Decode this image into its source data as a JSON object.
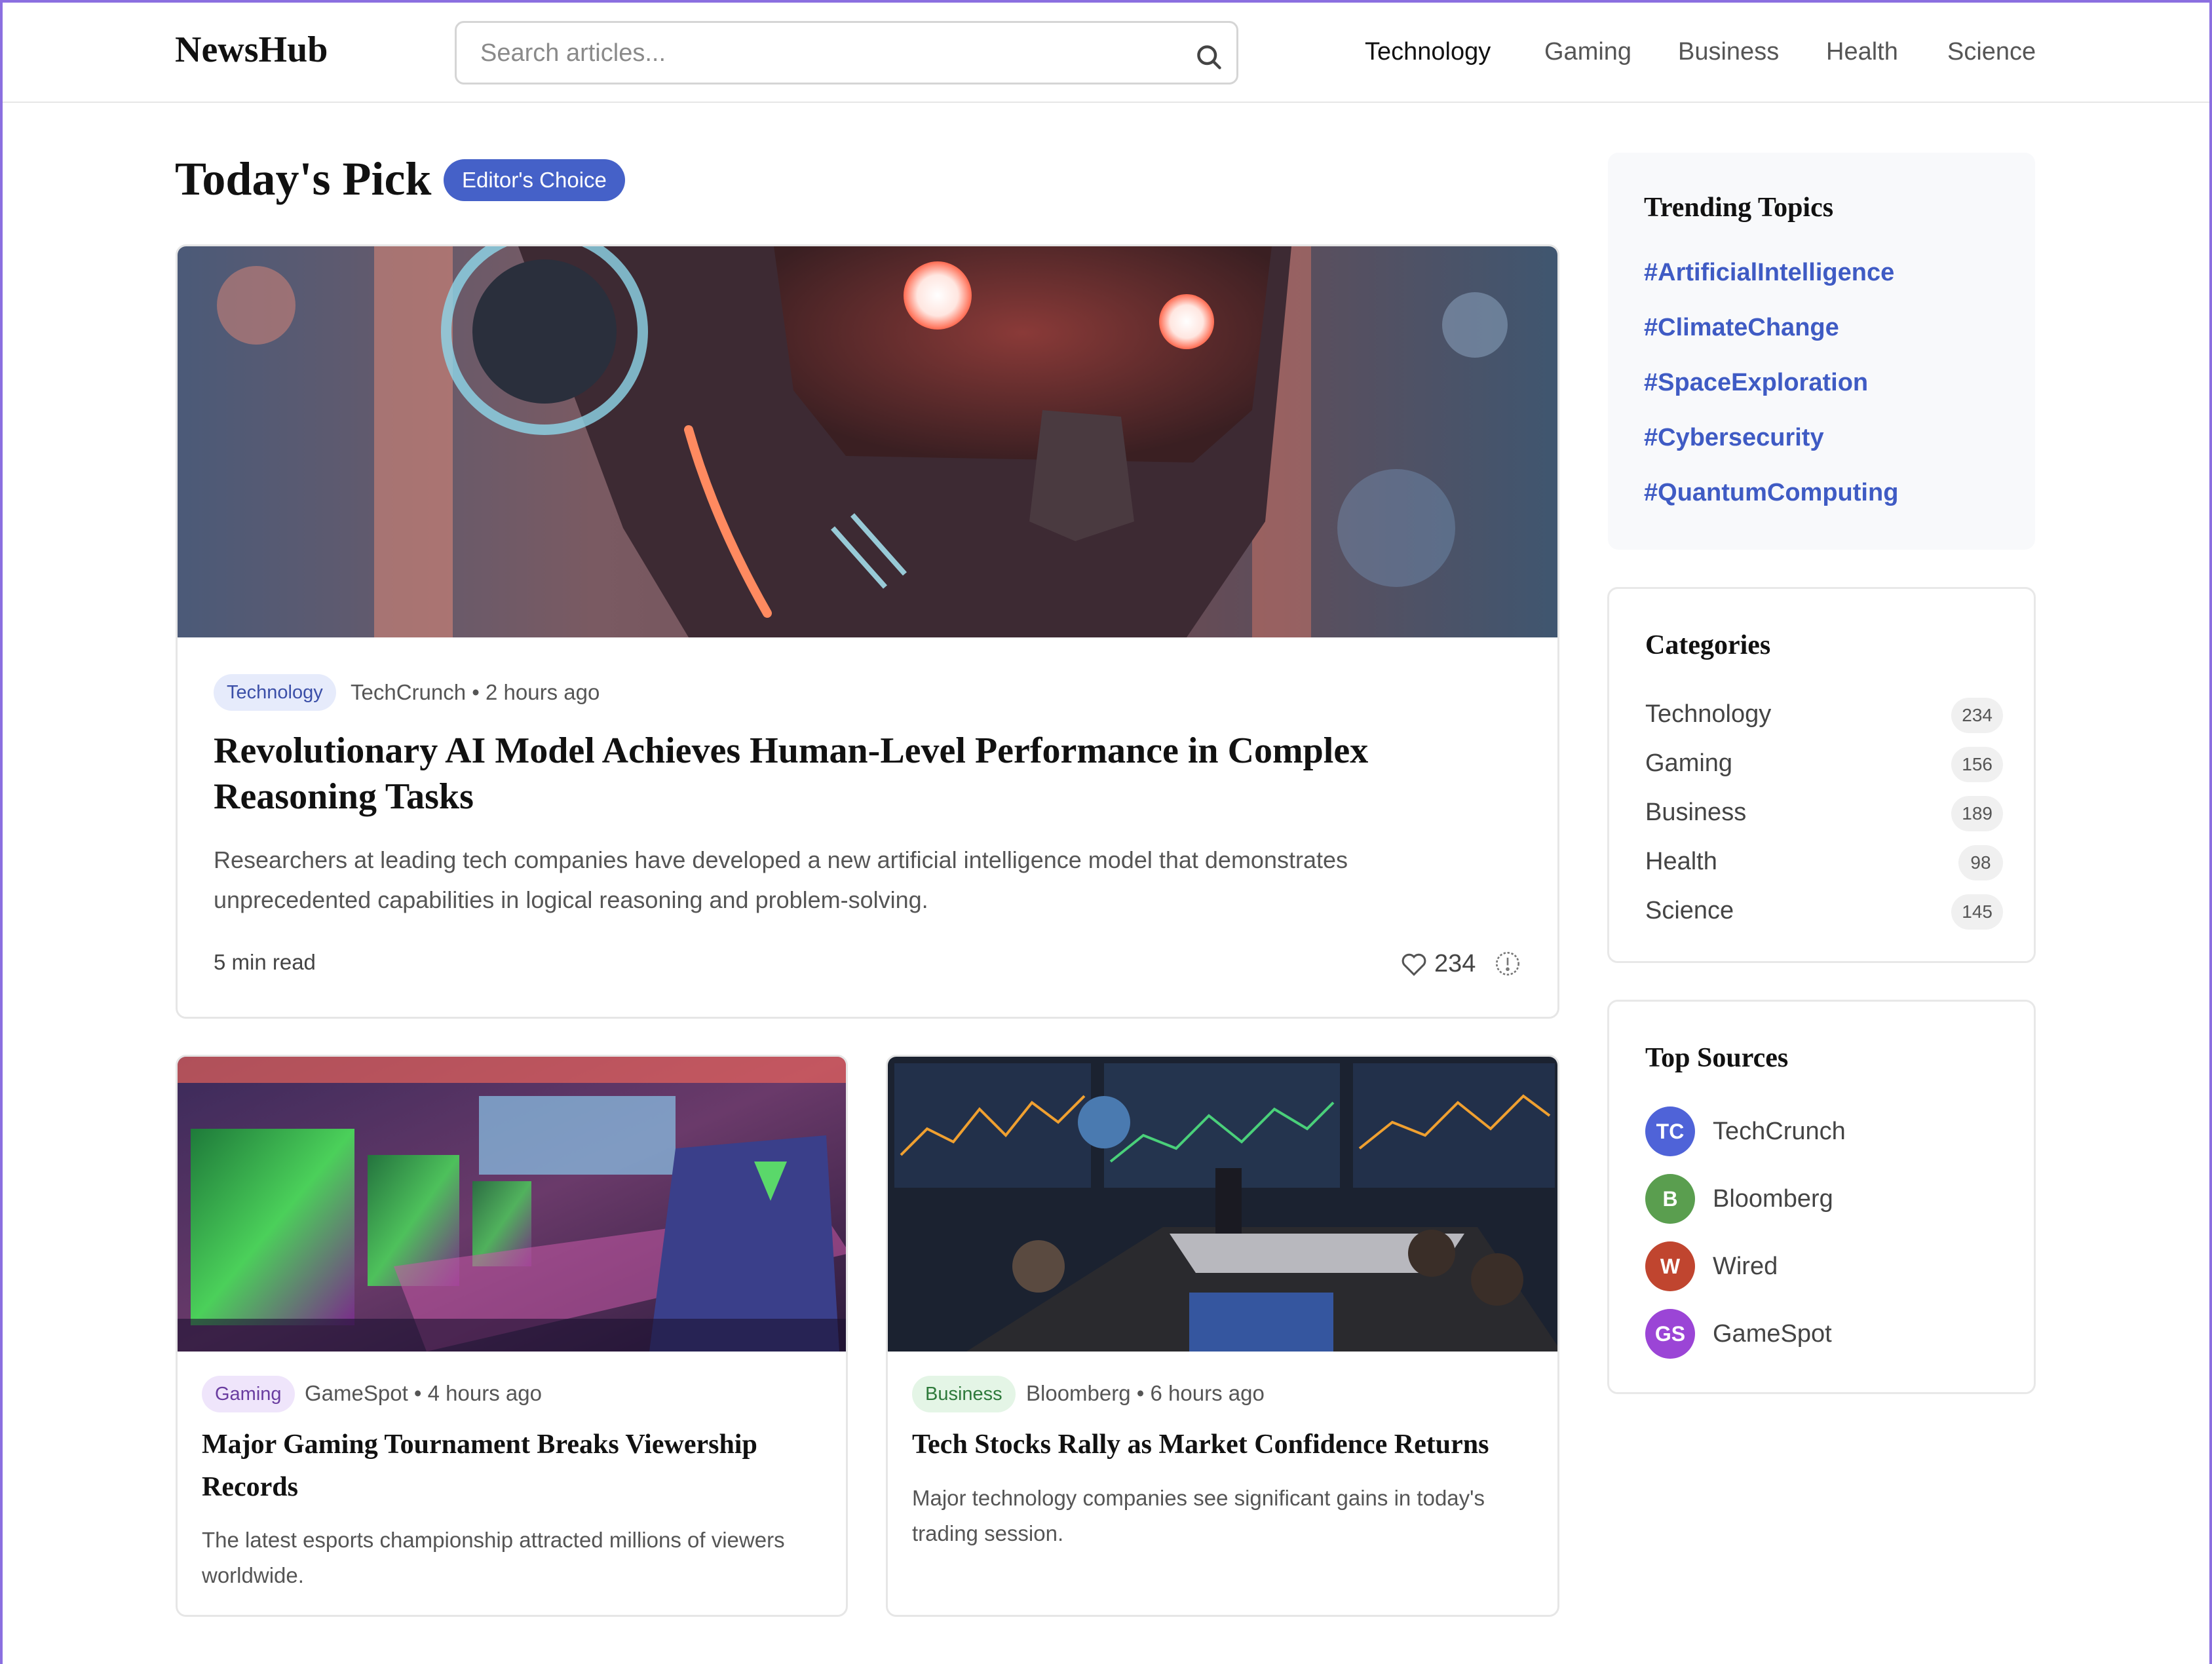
{
  "header": {
    "logo": "NewsHub",
    "search_placeholder": "Search articles...",
    "nav": [
      "Technology",
      "Gaming",
      "Business",
      "Health",
      "Science"
    ],
    "active_nav": "Technology"
  },
  "main": {
    "section_title": "Today's Pick",
    "badge": "Editor's Choice",
    "featured": {
      "tag": "Technology",
      "source": "TechCrunch",
      "time": "2 hours ago",
      "title": "Revolutionary AI Model Achieves Human-Level Performance in Complex Reasoning Tasks",
      "excerpt": "Researchers at leading tech companies have developed a new artificial intelligence model that demonstrates unprecedented capabilities in logical reasoning and problem-solving.",
      "read_time": "5 min read",
      "likes": "234"
    },
    "articles": [
      {
        "tag": "Gaming",
        "source": "GameSpot",
        "time": "4 hours ago",
        "title": "Major Gaming Tournament Breaks Viewership Records",
        "excerpt": "The latest esports championship attracted millions of viewers worldwide."
      },
      {
        "tag": "Business",
        "source": "Bloomberg",
        "time": "6 hours ago",
        "title": "Tech Stocks Rally as Market Confidence Returns",
        "excerpt": "Major technology companies see significant gains in today's trading session."
      }
    ]
  },
  "sidebar": {
    "trending": {
      "title": "Trending Topics",
      "topics": [
        "#ArtificialIntelligence",
        "#ClimateChange",
        "#SpaceExploration",
        "#Cybersecurity",
        "#QuantumComputing"
      ]
    },
    "categories": {
      "title": "Categories",
      "items": [
        {
          "name": "Technology",
          "count": "234"
        },
        {
          "name": "Gaming",
          "count": "156"
        },
        {
          "name": "Business",
          "count": "189"
        },
        {
          "name": "Health",
          "count": "98"
        },
        {
          "name": "Science",
          "count": "145"
        }
      ]
    },
    "sources": {
      "title": "Top Sources",
      "items": [
        {
          "initials": "TC",
          "name": "TechCrunch",
          "color": "#4f63d8"
        },
        {
          "initials": "B",
          "name": "Bloomberg",
          "color": "#5a9e4f"
        },
        {
          "initials": "W",
          "name": "Wired",
          "color": "#c0452f"
        },
        {
          "initials": "GS",
          "name": "GameSpot",
          "color": "#9b45d6"
        }
      ]
    }
  },
  "colors": {
    "accent": "#4561c8",
    "link": "#3f5bc4",
    "tech_tag_bg": "#e6ebfb",
    "tech_tag_fg": "#3b4fa8",
    "gaming_tag_bg": "#efe5fb",
    "gaming_tag_fg": "#6a3da0",
    "business_tag_bg": "#e4f5e6",
    "business_tag_fg": "#2e7a3b"
  }
}
